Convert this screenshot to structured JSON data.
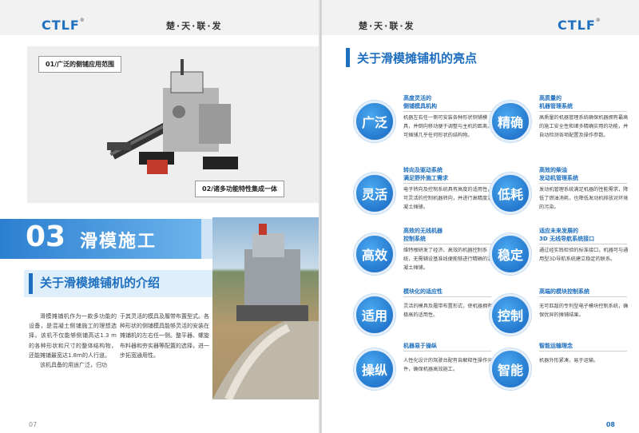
{
  "brand": {
    "logo": "CTLF",
    "slogan": "楚·天·联·发"
  },
  "left": {
    "page_number": "07",
    "photo1_label_top": "01/广泛的侧铺应用范围",
    "photo1_label_bottom": "02/诸多功能特性集成一体",
    "section_number": "03",
    "section_title": "滑模施工",
    "subheading": "关于滑模摊铺机的介绍",
    "col1": [
      "滑模摊铺机作为一款多功能的设备，是混凝土侧铺施工的理想选择。该机不仅能够侧铺高达1.3 m的各种形状和尺寸的整体结构物，还能摊铺最宽达1.8m的人行道。",
      "该机具备的用途广泛，归功"
    ],
    "col2": [
      "于其灵活的模具及履带布置型式。各种形状的侧铺模具能够灵活的安装在摊铺机的左右任一侧。整平器、螺旋布料器和夯实器等配置的选择，进一步拓宽通用性。"
    ]
  },
  "right": {
    "page_number": "08",
    "title": "关于滑模摊铺机的亮点",
    "features": [
      {
        "icon": "广泛",
        "title": "高度灵活的\n侧铺模具机构",
        "desc": "机器左右任一侧可安装各种形状侧铺模具，并倒向移动便于调整与主机的距离，可摊铺几乎任何形状的结构物。"
      },
      {
        "icon": "精确",
        "title": "高质量的\n机器管理系统",
        "desc": "高质量的机器管理系统确保机器拥有最高的施工安全性和诸多精确实用的功能，并自动检测各项配置及操作参数。"
      },
      {
        "icon": "灵活",
        "title": "转向及驱动系统\n满足野外施工需求",
        "desc": "电子转向及控制系统具有高度的适用性，可灵活的控制机器转向，并进行高精度混凝土摊铺。"
      },
      {
        "icon": "低耗",
        "title": "高效的柴油\n发动机管理系统",
        "desc": "发动机管理系统满足机器的性能需求，降低了燃油消耗，也降低发动机排放对环境的污染。"
      },
      {
        "icon": "高效",
        "title": "高效的无线机器\n控制系统",
        "desc": "维特根研发了经济、高效的机器控制系统，无需辅设基准线便能够进行精确的混凝土摊铺。"
      },
      {
        "icon": "稳定",
        "title": "适应未来发展的\n3D 无线导航系统接口",
        "desc": "通过经实践检验的标准接口，机器可与通用型3D导航系统建立稳定的联系。"
      },
      {
        "icon": "适用",
        "title": "模块化的适应性",
        "desc": "灵活的模具及履带布置形式，使机器拥有极高的适用性。"
      },
      {
        "icon": "控制",
        "title": "高端的模块控制系统",
        "desc": "无可匹敌的专利型电子模块控制系统，确保优异的摊铺结果。"
      },
      {
        "icon": "操纵",
        "title": "机器易于操纵",
        "desc": "人性化设计的驾驶台配有自解释性操作元件，确保机器高效施工。"
      },
      {
        "icon": "智能",
        "title": "智能运输理念",
        "desc": "机器外形紧凑，易于运输。"
      }
    ]
  },
  "colors": {
    "accent": "#1e6fbf",
    "header_bg": "#f2f2f2"
  }
}
